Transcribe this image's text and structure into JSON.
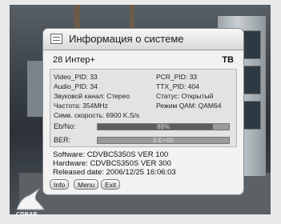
{
  "window": {
    "title": "Информация о системе"
  },
  "channel": {
    "name": "28 Интер+",
    "type": "ТВ"
  },
  "details": {
    "video_pid": "Video_PID: 33",
    "pcr_pid": "PCR_PID: 33",
    "audio_pid": "Audio_PID: 34",
    "ttx_pid": "TTX_PID: 404",
    "sound_channel": "Звуковой канал: Стерео",
    "status": "Статус: Открытый",
    "frequency": "Частота: 354MHz",
    "mode": "Режим QAM: QAM64",
    "symbol_rate": "Симв. скорость: 6900 K.S/s"
  },
  "meters": {
    "ebno_label": "Eb/No:",
    "ebno_value": "88%",
    "ebno_level": 0.88,
    "ber_label": "BER:",
    "ber_value": "0.E+00",
    "ber_level": 0.0
  },
  "software": {
    "software": "Software: CDVBC5350S VER 100",
    "hardware": "Hardware: CDVBC5350S VER 300",
    "released": "Released date: 2006/12/25 16:06:03"
  },
  "buttons": {
    "info": "Info",
    "menu": "Menu",
    "exit": "Exit"
  },
  "logo": {
    "text": "CDBAB"
  }
}
